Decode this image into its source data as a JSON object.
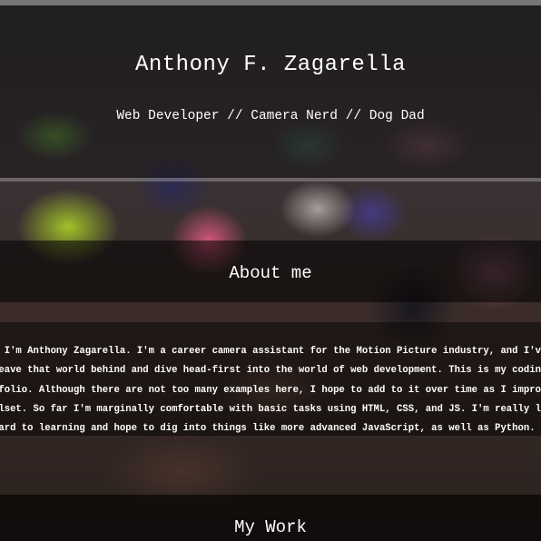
{
  "header": {
    "title": "Anthony F. Zagarella",
    "subtitle": "Web Developer // Camera Nerd // Dog Dad"
  },
  "about": {
    "heading": "About me",
    "lines": [
      "! I'm Anthony Zagarella. I'm a career camera assistant for the Motion Picture industry, and I've de",
      "leave that world behind and dive head-first into the world of web development. This is my coding",
      "tfolio. Although there are not too many examples here, I hope to add to it over time as I improve",
      "llset. So far I'm marginally comfortable with basic tasks using HTML, CSS, and JS. I'm really look",
      "ward to learning and hope to dig into things like more advanced JavaScript, as well as Python."
    ]
  },
  "work": {
    "heading": "My Work"
  }
}
